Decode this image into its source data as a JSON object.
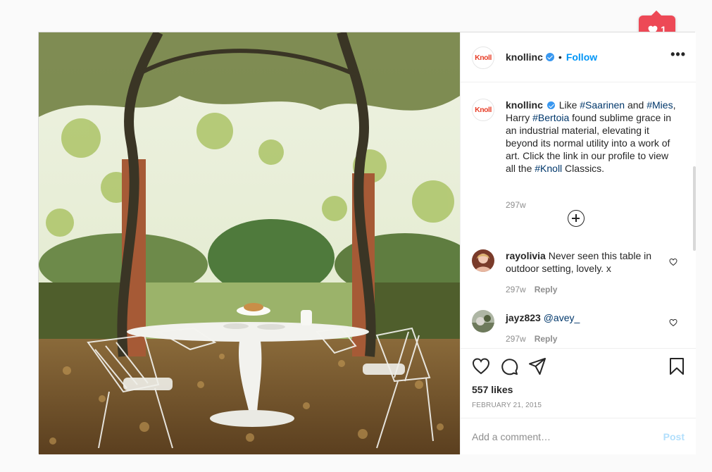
{
  "notification": {
    "icon": "heart-icon",
    "count": "1",
    "color": "#ed4956"
  },
  "header": {
    "avatar_logo": "Knoll",
    "username": "knollinc",
    "separator": "•",
    "follow_label": "Follow",
    "more_label": "•••"
  },
  "caption": {
    "avatar_logo": "Knoll",
    "username": "knollinc",
    "segments": [
      {
        "text": "Like ",
        "tag": false
      },
      {
        "text": "#Saarinen",
        "tag": true
      },
      {
        "text": " and ",
        "tag": false
      },
      {
        "text": "#Mies",
        "tag": true
      },
      {
        "text": ", Harry ",
        "tag": false
      },
      {
        "text": "#Bertoia",
        "tag": true
      },
      {
        "text": " found sublime grace in an industrial material, elevating it beyond its normal utility into a work of art. Click the link in our profile to view all the ",
        "tag": false
      },
      {
        "text": "#Knoll",
        "tag": true
      },
      {
        "text": " Classics.",
        "tag": false
      }
    ],
    "time": "297w"
  },
  "comments": [
    {
      "username": "rayolivia",
      "text": "Never seen this table in outdoor setting, lovely. x",
      "time": "297w",
      "reply_label": "Reply"
    },
    {
      "username": "jayz823",
      "text": "@avey_",
      "time": "297w",
      "reply_label": "Reply"
    }
  ],
  "actions": {
    "likes": "557 likes",
    "date": "FEBRUARY 21, 2015",
    "icons": [
      "heart-icon",
      "comment-icon",
      "share-icon",
      "bookmark-icon"
    ]
  },
  "add_comment": {
    "placeholder": "Add a comment…",
    "post_label": "Post"
  },
  "colors": {
    "link": "#0095f6",
    "hashtag": "#00376b",
    "verified": "#3897f0",
    "muted": "#8e8e8e",
    "brand": "#e8412b"
  }
}
